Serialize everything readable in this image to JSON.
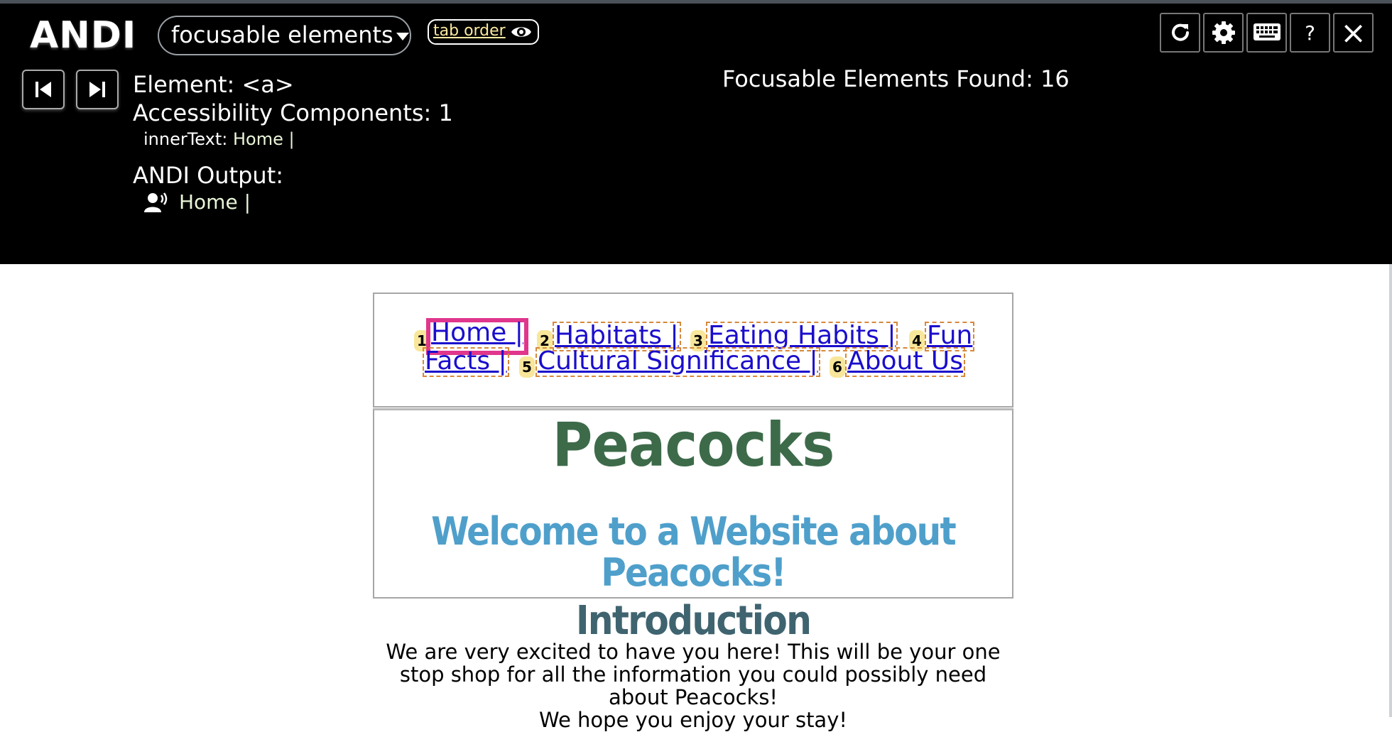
{
  "andi": {
    "logo": "ANDI",
    "mode": "focusable elements",
    "tab_order_label": "tab order",
    "element_label": "Element: <a>",
    "components_label": "Accessibility Components: 1",
    "inner_text_key": "innerText:",
    "inner_text_value": "Home |",
    "output_label": "ANDI Output:",
    "output_value": "Home |",
    "found_label": "Focusable Elements Found: 16",
    "buttons": [
      "refresh-icon",
      "gear-icon",
      "keyboard-icon",
      "?",
      "×"
    ]
  },
  "page": {
    "nav": [
      {
        "num": "1",
        "label": "Home | "
      },
      {
        "num": "2",
        "label": "Habitats | "
      },
      {
        "num": "3",
        "label": "Eating Habits | "
      },
      {
        "num": "4",
        "label": "Fun",
        "label_cont": "Facts | "
      },
      {
        "num": "5",
        "label": "Cultural Significance | "
      },
      {
        "num": "6",
        "label": "About Us"
      }
    ],
    "title": "Peacocks",
    "welcome": "Welcome to a Website about Peacocks!",
    "intro_heading": "Introduction",
    "intro_text": "We are very excited to have you here! This will be your one stop shop for all the information you could possibly need about Peacocks!",
    "intro_text_2": "We hope you enjoy your stay!"
  },
  "colors": {
    "andi_bg": "#000000",
    "link": "#1a0dcc",
    "focus_outline": "#e0368c",
    "badge": "#f8e79b",
    "title_green": "#3d6b4a",
    "welcome_blue": "#4f9fcb",
    "intro_heading": "#3f6470"
  }
}
